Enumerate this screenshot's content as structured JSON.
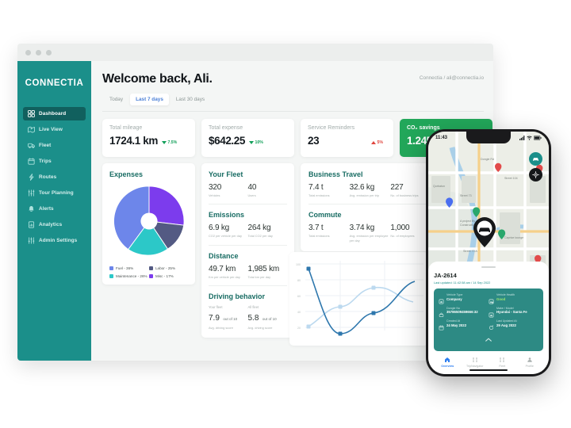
{
  "window": {
    "dots": 3
  },
  "sidebar": {
    "brand": "CONNECTIA",
    "items": [
      {
        "label": "Dashboard",
        "icon": "grid-icon",
        "active": true
      },
      {
        "label": "Live View",
        "icon": "live-map-icon",
        "active": false
      },
      {
        "label": "Fleet",
        "icon": "truck-icon",
        "active": false
      },
      {
        "label": "Trips",
        "icon": "calendar-icon",
        "active": false
      },
      {
        "label": "Routes",
        "icon": "route-icon",
        "active": false
      },
      {
        "label": "Tour Planning",
        "icon": "sliders-icon",
        "active": false
      },
      {
        "label": "Alerts",
        "icon": "bell-icon",
        "active": false
      },
      {
        "label": "Analytics",
        "icon": "chart-icon",
        "active": false
      },
      {
        "label": "Admin Settings",
        "icon": "sliders-icon",
        "active": false
      }
    ]
  },
  "header": {
    "title": "Welcome back, Ali.",
    "account": "Connectia / ali@connectia.io",
    "range_tabs": [
      {
        "label": "Today",
        "active": false
      },
      {
        "label": "Last 7 days",
        "active": true
      },
      {
        "label": "Last 30 days",
        "active": false
      }
    ]
  },
  "kpis": [
    {
      "label": "Total mileage",
      "value": "1724.1 km",
      "delta": "7.5%",
      "direction": "down",
      "accent": "white"
    },
    {
      "label": "Total expense",
      "value": "$642.25",
      "delta": "10%",
      "direction": "down",
      "accent": "white"
    },
    {
      "label": "Service Reminders",
      "value": "23",
      "delta": "5%",
      "direction": "up",
      "accent": "white"
    },
    {
      "label": "CO₂ savings",
      "value": "1.245",
      "delta": "",
      "direction": "",
      "accent": "green"
    }
  ],
  "expenses": {
    "title": "Expenses",
    "legend": [
      {
        "label": "Fuel - 36%",
        "color": "#6d86ea"
      },
      {
        "label": "Labor - 25%",
        "color": "#535a83"
      },
      {
        "label": "Maintenance - 26%",
        "color": "#2cc8c8"
      },
      {
        "label": "Misc - 17%",
        "color": "#7c3ced"
      }
    ]
  },
  "chart_data": [
    {
      "type": "pie",
      "title": "Expenses",
      "labels": [
        "Fuel",
        "Misc",
        "Labor",
        "Maintenance"
      ],
      "values": [
        36,
        17,
        25,
        26
      ],
      "colors": [
        "#6d86ea",
        "#7c3ced",
        "#535a83",
        "#2cc8c8"
      ],
      "donut": true,
      "legend_position": "bottom"
    },
    {
      "type": "line",
      "title": "",
      "x": [
        1,
        2,
        3,
        4,
        5
      ],
      "series": [
        {
          "name": "series-dark",
          "values": [
            92,
            10,
            32,
            58,
            72
          ],
          "color": "#1f6496"
        },
        {
          "name": "series-light",
          "values": [
            23,
            46,
            67,
            57,
            40
          ],
          "color": "#bcd9ef"
        }
      ],
      "ylabel": "",
      "xlabel": "",
      "yticks": [
        20,
        40,
        60,
        80,
        100
      ],
      "ylim": [
        0,
        105
      ],
      "grid": true
    }
  ],
  "fleet": {
    "sections": [
      {
        "title": "Your Fleet",
        "metrics": [
          {
            "value": "320",
            "sub": "Vehicles"
          },
          {
            "value": "40",
            "sub": "Users"
          }
        ]
      },
      {
        "title": "Emissions",
        "metrics": [
          {
            "value": "6.9 kg",
            "sub": "CO2 per vehicle per day"
          },
          {
            "value": "264 kg",
            "sub": "Total CO2 per day"
          }
        ]
      },
      {
        "title": "Distance",
        "metrics": [
          {
            "value": "49.7 km",
            "sub": "Km per vehicle per day"
          },
          {
            "value": "1,985 km",
            "sub": "Total km per day"
          }
        ]
      }
    ],
    "driving": {
      "title": "Driving behavior",
      "scores": [
        {
          "top": "Your fleet",
          "value": "7.9",
          "out": "out of 10",
          "sub": "Avg. driving score"
        },
        {
          "top": "All fleet",
          "value": "5.8",
          "out": "out of 10",
          "sub": "Avg. driving score"
        }
      ]
    }
  },
  "travel": {
    "sections": [
      {
        "title": "Business Travel",
        "metrics": [
          {
            "value": "7.4 t",
            "sub": "Total emissions"
          },
          {
            "value": "32.6 kg",
            "sub": "Avg. emission per trip"
          },
          {
            "value": "227",
            "sub": "No. of business trips"
          }
        ]
      },
      {
        "title": "Commute",
        "metrics": [
          {
            "value": "3.7 t",
            "sub": "Total emissions"
          },
          {
            "value": "3.74 kg",
            "sub": "Avg. emission per employee per day"
          },
          {
            "value": "1,000",
            "sub": "No. of employees"
          }
        ]
      }
    ]
  },
  "phone": {
    "status": {
      "time": "11:43",
      "carrier_icon": "signal-icon",
      "wifi_icon": "wifi-icon",
      "battery": "80"
    },
    "map": {
      "fab_vehicle_icon": "car-icon",
      "fab_locate_icon": "locate-icon",
      "main_pin_icon": "car-pin-icon",
      "labels": [
        "Caprice lounge",
        "Sarah's biryani and BBQ",
        "A project By Construction Hub",
        "Qurbatun",
        "Punai CTY CO.",
        "Street 73",
        "Street 70 A",
        "Street 70 K",
        "Street 60A",
        "Street 104",
        "Man Double Rd",
        "Dongle Rd"
      ]
    },
    "vehicle": {
      "id": "JA-2614",
      "updated": "Last updated: 11:42:58 am / 14 Sep 2022",
      "fields": [
        {
          "key": "Vehicle Type",
          "value": "Company",
          "icon": "car-type-icon",
          "good": false
        },
        {
          "key": "Vehicle Health",
          "value": "Good",
          "icon": "car-health-icon",
          "good": true
        },
        {
          "key": "Dongle No",
          "value": "35786509459666:32",
          "icon": "dongle-icon",
          "good": false
        },
        {
          "key": "Make / Model",
          "value": "Hyundai - Santa Fe",
          "icon": "car-model-icon",
          "good": false
        },
        {
          "key": "Created At",
          "value": "24 May 2022",
          "icon": "calendar-icon",
          "good": false
        },
        {
          "key": "Last Updated At",
          "value": "29 Aug 2022",
          "icon": "refresh-icon",
          "good": false
        }
      ],
      "collapse_icon": "chevron-up-icon"
    },
    "tabs": [
      {
        "label": "Overview",
        "icon": "home-icon",
        "active": true
      },
      {
        "label": "TripNavigator",
        "icon": "nav-icon",
        "active": false
      },
      {
        "label": "Fleet",
        "icon": "fleet-icon",
        "active": false
      },
      {
        "label": "Profile",
        "icon": "profile-icon",
        "active": false
      }
    ]
  }
}
